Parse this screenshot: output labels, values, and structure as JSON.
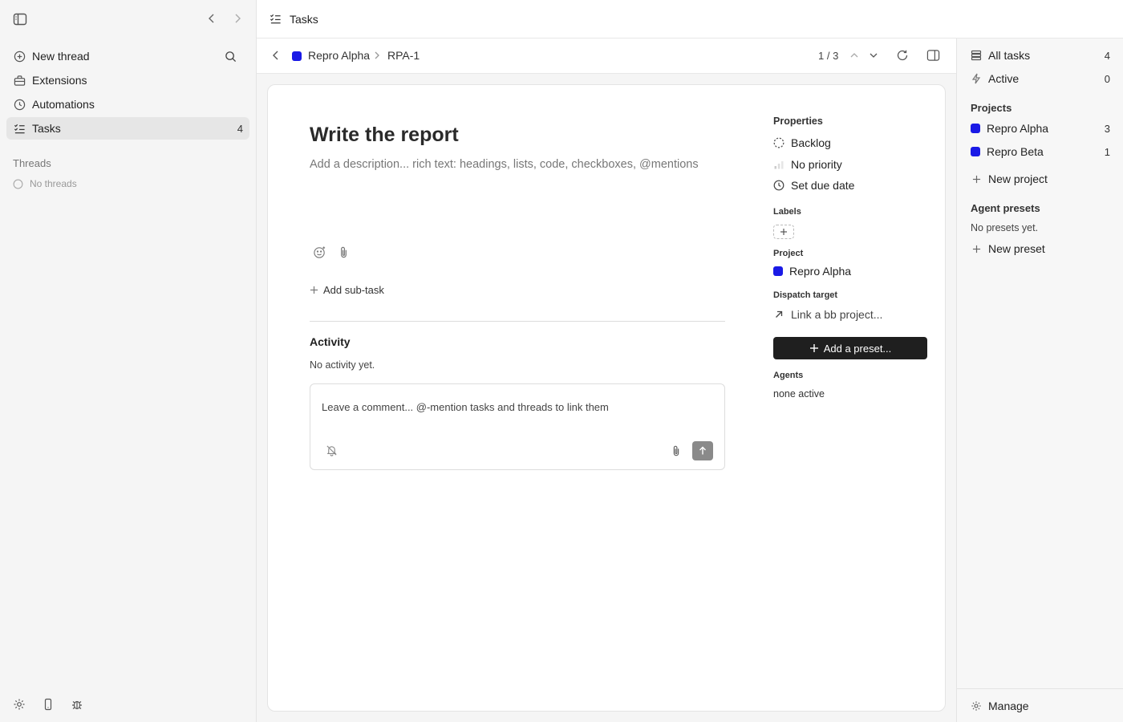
{
  "topbar": {
    "title": "Tasks",
    "icon": "list-check-icon"
  },
  "sidebar": {
    "items": [
      {
        "label": "New thread",
        "icon": "plus-circle-icon"
      },
      {
        "label": "Extensions",
        "icon": "toolbox-icon"
      },
      {
        "label": "Automations",
        "icon": "clock-icon"
      },
      {
        "label": "Tasks",
        "icon": "list-check-icon",
        "count": "4",
        "active": true
      }
    ],
    "threads_heading": "Threads",
    "no_threads": "No threads"
  },
  "taskbar": {
    "project": "Repro Alpha",
    "project_color": "#1a1ae6",
    "task_id": "RPA-1",
    "pager": "1 / 3"
  },
  "task": {
    "title": "Write the report",
    "description_placeholder": "Add a description... rich text: headings, lists, code, checkboxes, @mentions",
    "add_subtask": "Add sub-task",
    "activity_heading": "Activity",
    "activity_empty": "No activity yet.",
    "comment_placeholder": "Leave a comment... @-mention tasks and threads to link them"
  },
  "properties": {
    "heading": "Properties",
    "status": "Backlog",
    "priority": "No priority",
    "due_date": "Set due date",
    "labels_heading": "Labels",
    "project_heading": "Project",
    "project": "Repro Alpha",
    "project_color": "#1a1ae6",
    "dispatch_heading": "Dispatch target",
    "dispatch_link": "Link a bb project...",
    "preset_button": "Add a preset...",
    "agents_heading": "Agents",
    "agents_value": "none active"
  },
  "rightpanel": {
    "all_tasks": {
      "label": "All tasks",
      "count": "4"
    },
    "active": {
      "label": "Active",
      "count": "0"
    },
    "projects_heading": "Projects",
    "projects": [
      {
        "label": "Repro Alpha",
        "count": "3",
        "color": "#1a1ae6"
      },
      {
        "label": "Repro Beta",
        "count": "1",
        "color": "#1a1ae6"
      }
    ],
    "new_project": "New project",
    "presets_heading": "Agent presets",
    "no_presets": "No presets yet.",
    "new_preset": "New preset",
    "manage": "Manage"
  }
}
